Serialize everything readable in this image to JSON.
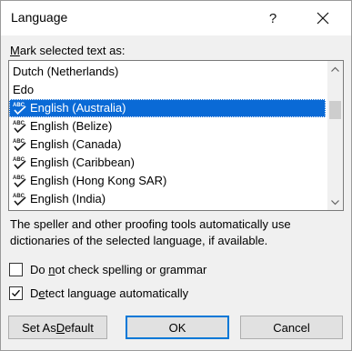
{
  "window": {
    "title": "Language",
    "help_label": "?"
  },
  "mark_label": {
    "mnemonic": "M",
    "rest": "ark selected text as:"
  },
  "languages": [
    {
      "label": "Dutch (Netherlands)",
      "icon": "none",
      "selected": false
    },
    {
      "label": "Edo",
      "icon": "none",
      "selected": false
    },
    {
      "label": "English (Australia)",
      "icon": "spell-check-icon",
      "selected": true
    },
    {
      "label": "English (Belize)",
      "icon": "spell-check-icon",
      "selected": false
    },
    {
      "label": "English (Canada)",
      "icon": "spell-check-icon",
      "selected": false
    },
    {
      "label": "English (Caribbean)",
      "icon": "spell-check-icon",
      "selected": false
    },
    {
      "label": "English (Hong Kong SAR)",
      "icon": "spell-check-icon",
      "selected": false
    },
    {
      "label": "English (India)",
      "icon": "spell-check-icon",
      "selected": false
    }
  ],
  "description": "The speller and other proofing tools automatically use dictionaries of the selected language, if available.",
  "options": {
    "no_check": {
      "pre": "Do ",
      "mnemonic": "n",
      "post": "ot check spelling or grammar",
      "checked": false
    },
    "detect": {
      "pre": "D",
      "mnemonic": "e",
      "post": "tect language automatically",
      "checked": true
    }
  },
  "buttons": {
    "set_default": {
      "pre": "Set As ",
      "mnemonic": "D",
      "post": "efault"
    },
    "ok": "OK",
    "cancel": "Cancel"
  },
  "colors": {
    "selection": "#0a6ad6",
    "dialog_bg": "#f0f0f0",
    "focus_border": "#0078d7"
  }
}
